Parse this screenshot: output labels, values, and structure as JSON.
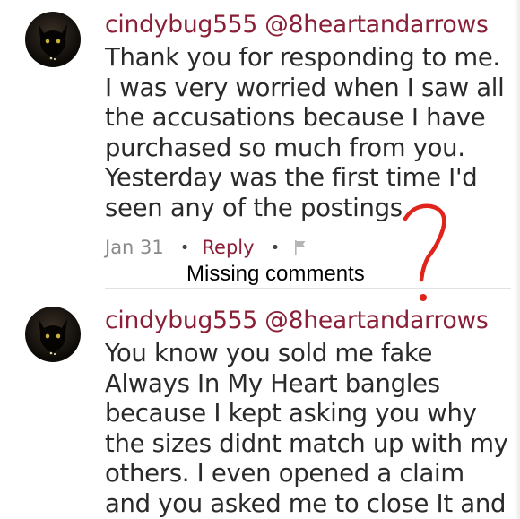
{
  "comments": [
    {
      "handle": "cindybug555 @8heartandarrows",
      "lines": [
        "Thank you for responding to me.",
        "I was very worried when I saw all",
        "the accusations because I have",
        "purchased so much from you.",
        "Yesterday was the first time I'd",
        "seen any of the postings"
      ],
      "date": "Jan 31",
      "reply_label": "Reply"
    },
    {
      "handle": "cindybug555 @8heartandarrows",
      "lines": [
        "You know you sold me fake",
        "Always In My Heart bangles",
        "because I kept asking you why",
        "the sizes didnt match up with my",
        "others.  I even opened a claim",
        "and you asked me to close It and"
      ]
    }
  ],
  "annotation": {
    "text": "Missing comments",
    "mark_color": "#e0241b"
  },
  "colors": {
    "handle": "#8a1f37",
    "body": "#2a2a2a",
    "meta": "#8a8a8a"
  },
  "icons": [
    "avatar-cat",
    "flag-icon",
    "question-mark-annotation"
  ]
}
